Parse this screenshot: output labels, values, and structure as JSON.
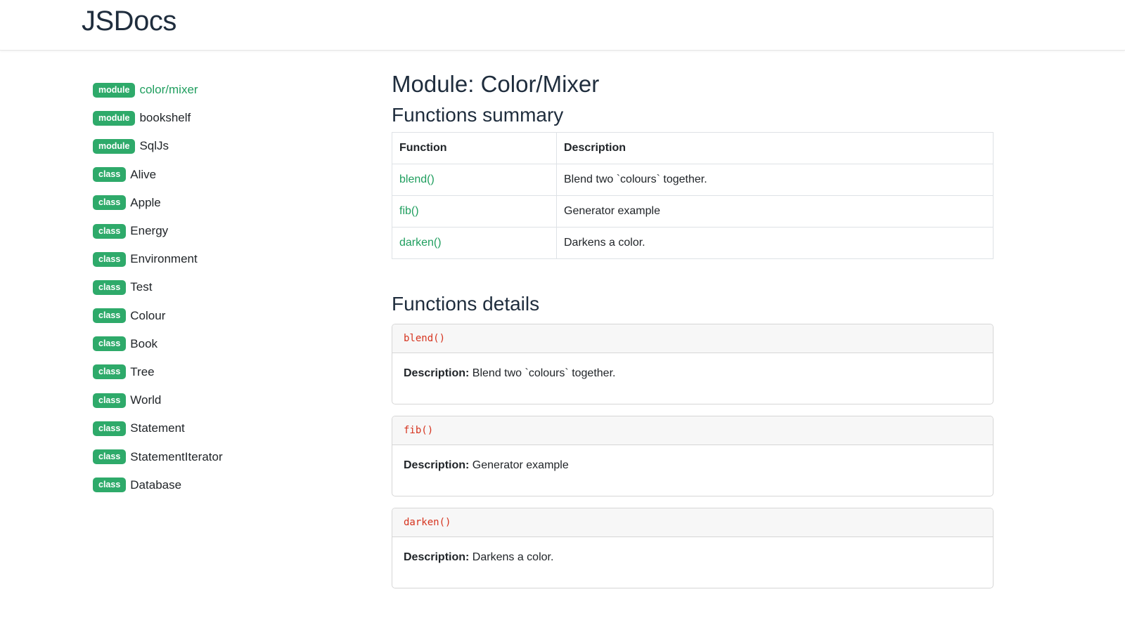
{
  "header": {
    "brand": "JSDocs"
  },
  "sidebar": {
    "items": [
      {
        "badge": "module",
        "label": "color/mixer",
        "active": true
      },
      {
        "badge": "module",
        "label": "bookshelf"
      },
      {
        "badge": "module",
        "label": "SqlJs"
      },
      {
        "badge": "class",
        "label": "Alive"
      },
      {
        "badge": "class",
        "label": "Apple"
      },
      {
        "badge": "class",
        "label": "Energy"
      },
      {
        "badge": "class",
        "label": "Environment"
      },
      {
        "badge": "class",
        "label": "Test"
      },
      {
        "badge": "class",
        "label": "Colour"
      },
      {
        "badge": "class",
        "label": "Book"
      },
      {
        "badge": "class",
        "label": "Tree"
      },
      {
        "badge": "class",
        "label": "World"
      },
      {
        "badge": "class",
        "label": "Statement"
      },
      {
        "badge": "class",
        "label": "StatementIterator"
      },
      {
        "badge": "class",
        "label": "Database"
      }
    ]
  },
  "main": {
    "title": "Module: Color/Mixer",
    "summary": {
      "title": "Functions summary",
      "headers": {
        "function": "Function",
        "description": "Description"
      },
      "rows": [
        {
          "function": "blend()",
          "description": "Blend two `colours` together."
        },
        {
          "function": "fib()",
          "description": "Generator example"
        },
        {
          "function": "darken()",
          "description": "Darkens a color."
        }
      ]
    },
    "details": {
      "title": "Functions details",
      "description_label": "Description:",
      "items": [
        {
          "signature": "blend()",
          "description": "Blend two `colours` together."
        },
        {
          "signature": "fib()",
          "description": "Generator example"
        },
        {
          "signature": "darken()",
          "description": "Darkens a color."
        }
      ]
    }
  },
  "colors": {
    "badge": "#2eaa6a",
    "link": "#1f9e5e",
    "code": "#d6331e",
    "heading": "#1f2d3d"
  }
}
